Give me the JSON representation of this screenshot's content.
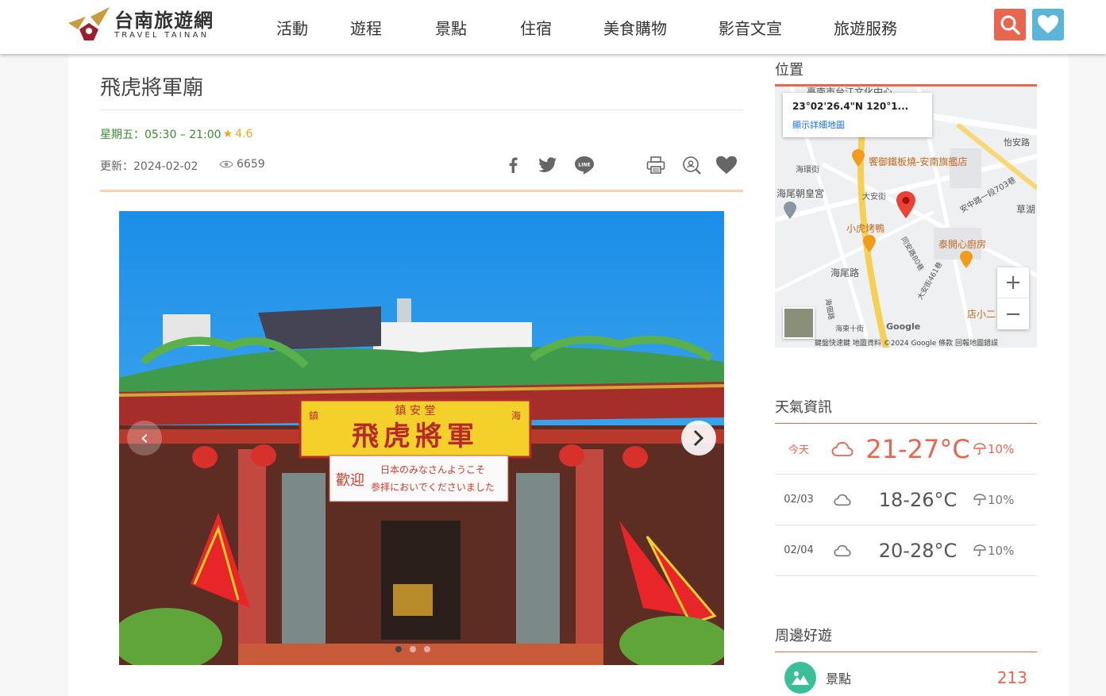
{
  "header": {
    "logo_title": "台南旅遊網",
    "logo_sub": "TRAVEL TAINAN",
    "nav": [
      "活動",
      "遊程",
      "景點",
      "住宿",
      "美食購物",
      "影音文宣",
      "旅遊服務"
    ],
    "colors": {
      "search": "#e8654f",
      "favorite": "#5bb5d8"
    }
  },
  "article": {
    "title": "飛虎將軍廟",
    "hours": "星期五：05:30 – 21:00",
    "rating": "4.6",
    "updated": "更新：2024-02-02",
    "views": "6659",
    "share_icons": [
      "facebook-icon",
      "twitter-icon",
      "line-icon",
      "print-icon",
      "search-location-icon",
      "heart-icon"
    ]
  },
  "photo": {
    "banner_top": "鎮 安 堂",
    "banner_main": "飛虎將軍",
    "banner_small_left": "鎮",
    "banner_small_right": "海",
    "welcome_left": "歡迎",
    "welcome_line1": "日本のみなさんようこそ",
    "welcome_line2": "参拝においでくださいました",
    "slide_count": 3,
    "active_slide": 1
  },
  "sidebar": {
    "location_title": "位置",
    "map": {
      "coord": "23°02'26.4\"N 120°1...",
      "link": "顯示詳細地圖",
      "labels": [
        "臺南市台江文化中心",
        "海尾朝皇宮",
        "海環街",
        "大安街",
        "海尾路",
        "安中路一段703巷",
        "草湖",
        "怡安路",
        "同安路80巷",
        "大安街461巷",
        "海東十街",
        "海佃路"
      ],
      "pois": [
        "饗御鐵板燒-安南旗艦店",
        "小虎烤鴨",
        "泰開心廚房",
        "店小二"
      ],
      "footer": "鍵盤快速鍵  地圖資料 ©2024 Google  條款  回報地圖錯誤",
      "zoom_in": "+",
      "zoom_out": "−",
      "google": "Google"
    },
    "weather_title": "天氣資訊",
    "weather": [
      {
        "date": "今天",
        "temp": "21-27°C",
        "rain": "10%"
      },
      {
        "date": "02/03",
        "temp": "18-26°C",
        "rain": "10%"
      },
      {
        "date": "02/04",
        "temp": "20-28°C",
        "rain": "10%"
      }
    ],
    "nearby_title": "周邊好遊",
    "nearby": {
      "label": "景點",
      "count": "213"
    }
  }
}
